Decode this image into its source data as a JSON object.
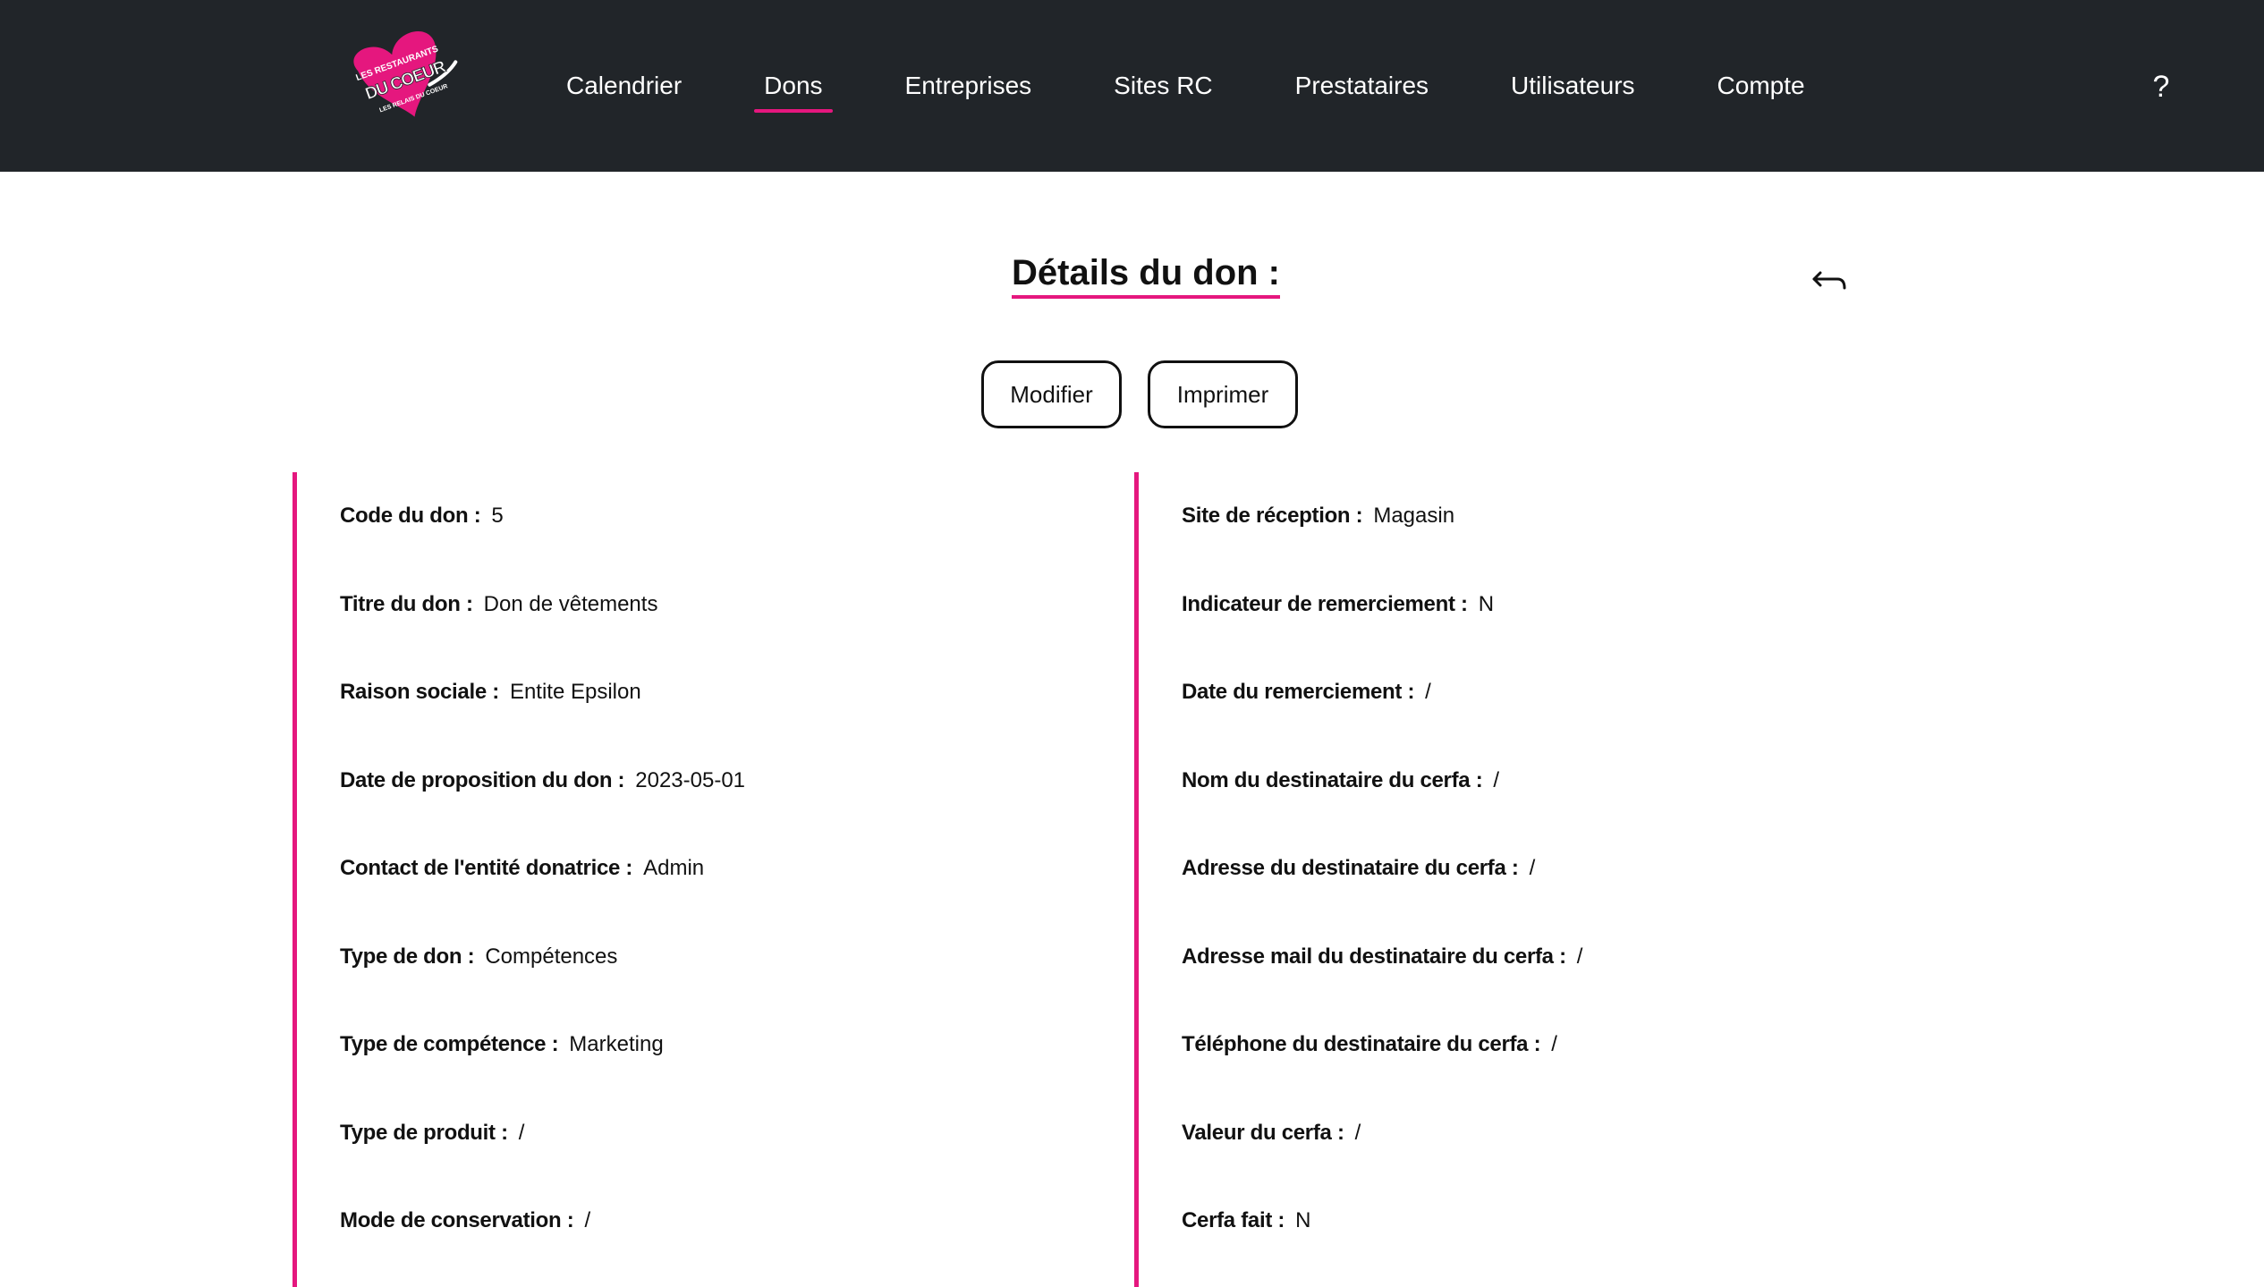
{
  "colors": {
    "accent": "#e5177e",
    "header_bg": "#212529"
  },
  "logo": {
    "line1": "LES RESTAURANTS",
    "line2": "DU COEUR",
    "line3": "LES RELAIS DU COEUR"
  },
  "nav": {
    "items": [
      "Calendrier",
      "Dons",
      "Entreprises",
      "Sites RC",
      "Prestataires",
      "Utilisateurs",
      "Compte"
    ],
    "active_index": 1,
    "help": "?"
  },
  "page": {
    "title": "Détails du don :"
  },
  "actions": {
    "edit_label": "Modifier",
    "print_label": "Imprimer"
  },
  "details": {
    "left": [
      {
        "label": "Code du don :",
        "value": "5"
      },
      {
        "label": "Titre du don :",
        "value": "Don de vêtements"
      },
      {
        "label": "Raison sociale :",
        "value": "Entite Epsilon"
      },
      {
        "label": "Date de proposition du don :",
        "value": "2023-05-01"
      },
      {
        "label": "Contact de l'entité donatrice :",
        "value": "Admin"
      },
      {
        "label": "Type de don :",
        "value": "Compétences"
      },
      {
        "label": "Type de compétence :",
        "value": "Marketing"
      },
      {
        "label": "Type de produit :",
        "value": "/"
      },
      {
        "label": "Mode de conservation :",
        "value": "/"
      }
    ],
    "right": [
      {
        "label": "Site de réception :",
        "value": "Magasin"
      },
      {
        "label": "Indicateur de remerciement :",
        "value": "N"
      },
      {
        "label": "Date du remerciement :",
        "value": "/"
      },
      {
        "label": "Nom du destinataire du cerfa :",
        "value": "/"
      },
      {
        "label": "Adresse du destinataire du cerfa :",
        "value": "/"
      },
      {
        "label": "Adresse mail du destinataire du cerfa :",
        "value": "/"
      },
      {
        "label": "Téléphone du destinataire du cerfa :",
        "value": "/"
      },
      {
        "label": "Valeur du cerfa :",
        "value": "/"
      },
      {
        "label": "Cerfa fait :",
        "value": "N"
      }
    ]
  }
}
